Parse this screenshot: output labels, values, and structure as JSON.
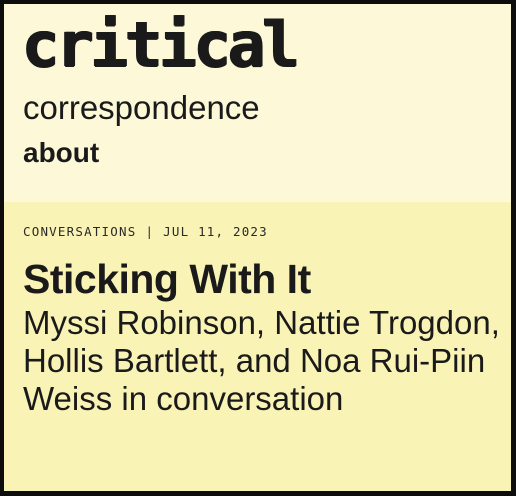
{
  "site": {
    "logo_top": "critical",
    "logo_bottom": "correspondence"
  },
  "nav": {
    "about": "about"
  },
  "article": {
    "category": "CONVERSATIONS",
    "separator": "|",
    "date": "JUL 11, 2023",
    "title": "Sticking With It",
    "subtitle": "Myssi Robinson, Nattie Trogdon, Hollis Bartlett, and Noa Rui-Piin Weiss in conversation"
  }
}
